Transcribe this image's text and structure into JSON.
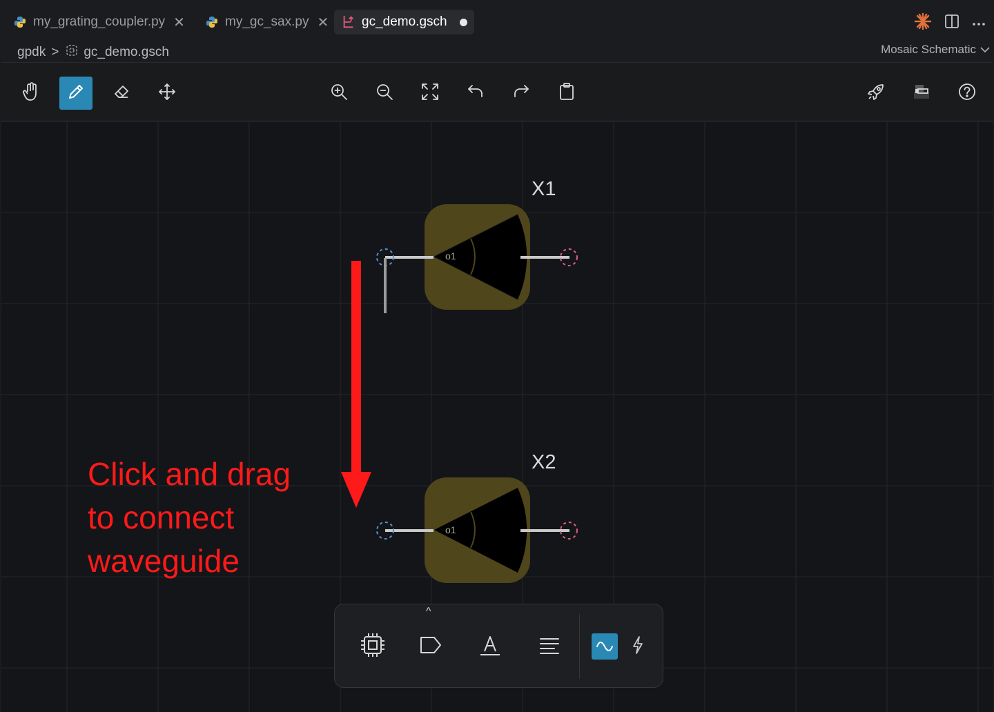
{
  "tabs": [
    {
      "label": "my_grating_coupler.py",
      "icon": "python-icon",
      "close": "✕"
    },
    {
      "label": "my_gc_sax.py",
      "icon": "python-icon",
      "close": "✕"
    },
    {
      "label": "gc_demo.gsch",
      "icon": "schematic-icon",
      "active": true,
      "modified": true
    }
  ],
  "breadcrumb": {
    "root": "gpdk",
    "separator": ">",
    "file": "gc_demo.gsch"
  },
  "editor_mode": {
    "label": "Mosaic Schematic"
  },
  "toolbar": {
    "left_tools": [
      "hand-icon",
      "pencil-icon",
      "eraser-icon",
      "move-icon"
    ],
    "active_tool": "pencil-icon",
    "center_tools": [
      "zoom-in-icon",
      "zoom-out-icon",
      "fit-view-icon",
      "undo-icon",
      "redo-icon",
      "clipboard-icon"
    ],
    "right_tools": [
      "rocket-icon",
      "component-icon",
      "help-icon"
    ]
  },
  "components": [
    {
      "name": "X1",
      "port_label": "o1"
    },
    {
      "name": "X2",
      "port_label": "o1"
    }
  ],
  "annotation": {
    "text": "Click and drag\nto connect\nwaveguide",
    "color": "#ff1a1a"
  },
  "palette": {
    "tools": [
      "chip-icon",
      "port-tag-icon",
      "text-icon",
      "align-icon"
    ],
    "mode_toggle": [
      "optical-wave-icon",
      "electrical-bolt-icon"
    ],
    "active_mode": "optical-wave-icon",
    "expand": "^"
  },
  "colors": {
    "accent": "#2a88b5",
    "component_fill": "#4f461c",
    "annotation": "#ff1a1a",
    "port_in": "#5b8fd9",
    "port_out": "#d9607f"
  }
}
